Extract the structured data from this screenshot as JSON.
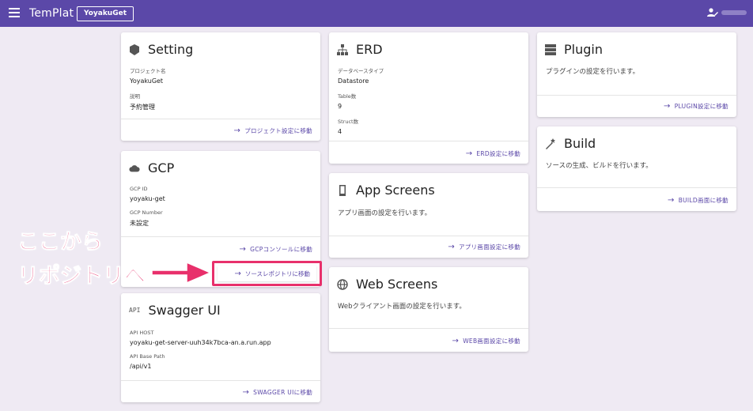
{
  "appbar": {
    "title": "TemPlat",
    "project_chip": "YoyakuGet"
  },
  "cards": {
    "setting": {
      "title": "Setting",
      "fields": [
        {
          "label": "プロジェクト名",
          "value": "YoyakuGet"
        },
        {
          "label": "説明",
          "value": "予約管理"
        }
      ],
      "action": "プロジェクト設定に移動"
    },
    "gcp": {
      "title": "GCP",
      "fields": [
        {
          "label": "GCP ID",
          "value": "yoyaku-get"
        },
        {
          "label": "GCP Number",
          "value": "未設定"
        }
      ],
      "action": "GCPコンソールに移動",
      "action2": "ソースレポジトリに移動"
    },
    "swagger": {
      "title": "Swagger UI",
      "icon_text": "API",
      "fields": [
        {
          "label": "API HOST",
          "value": "yoyaku-get-server-uuh34k7bca-an.a.run.app"
        },
        {
          "label": "API Base Path",
          "value": "/api/v1"
        }
      ],
      "action": "SWAGGER UIに移動"
    },
    "erd": {
      "title": "ERD",
      "fields": [
        {
          "label": "データベースタイプ",
          "value": "Datastore"
        },
        {
          "label": "Table数",
          "value": "9"
        },
        {
          "label": "Struct数",
          "value": "4"
        }
      ],
      "action": "ERD設定に移動"
    },
    "app_screens": {
      "title": "App Screens",
      "description": "アプリ画面の設定を行います。",
      "action": "アプリ画面設定に移動"
    },
    "web_screens": {
      "title": "Web Screens",
      "description": "Webクライアント画面の設定を行います。",
      "action": "WEB画面設定に移動"
    },
    "plugin": {
      "title": "Plugin",
      "description": "プラグインの設定を行います。",
      "action": "PLUGIN設定に移動"
    },
    "build": {
      "title": "Build",
      "description": "ソースの生成、ビルドを行います。",
      "action": "BUILD画面に移動"
    }
  },
  "annotation": {
    "line1": "ここから",
    "line2": "リポジトリへ",
    "color": "#e8306b"
  },
  "icons": {
    "menu": "hamburger-icon",
    "user": "user-edit-icon",
    "setting": "cube-icon",
    "gcp": "cloud-icon",
    "erd": "sitemap-icon",
    "app_screens": "mobile-icon",
    "web_screens": "globe-icon",
    "plugin": "server-icon",
    "build": "magic-wand-icon",
    "action": "arrow-right-icon"
  },
  "colors": {
    "appbar": "#5b48a8",
    "background": "#efeaf3",
    "accent": "#5b48a8"
  }
}
